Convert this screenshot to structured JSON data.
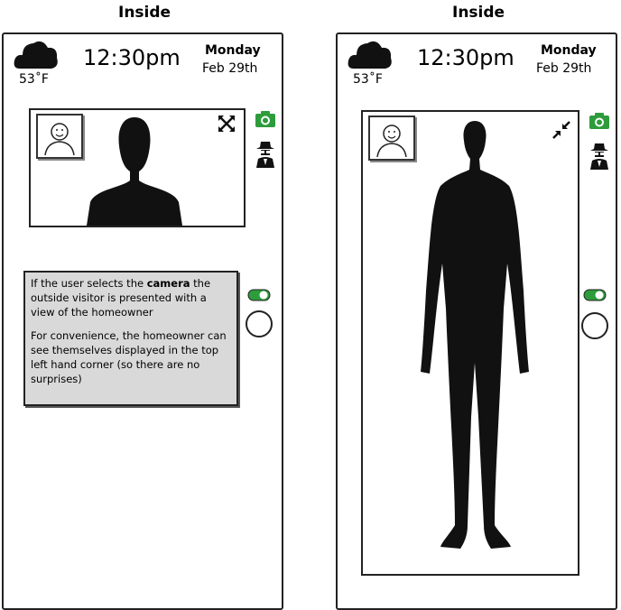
{
  "left_panel": {
    "title": "Inside",
    "weather": {
      "icon": "cloud-icon",
      "temperature": "53˚F"
    },
    "time": "12:30pm",
    "day": "Monday",
    "date": "Feb 29th",
    "note": {
      "p1_prefix": "If the user selects the ",
      "p1_bold": "camera",
      "p1_suffix": " the outside visitor is presented with a view of the homeowner",
      "p2": "For convenience, the homeowner can see themselves displayed in the top left hand corner (so there are no surprises)"
    }
  },
  "right_panel": {
    "title": "Inside",
    "weather": {
      "icon": "cloud-icon",
      "temperature": "53˚F"
    },
    "time": "12:30pm",
    "day": "Monday",
    "date": "Feb 29th"
  },
  "colors": {
    "accent_green": "#2e9c3c",
    "frame": "#222222",
    "note_bg": "#d9d9d9"
  },
  "icons": [
    "cloud-icon",
    "camera-icon",
    "spy-icon",
    "expand-icon",
    "collapse-icon",
    "toggle-on-icon"
  ]
}
